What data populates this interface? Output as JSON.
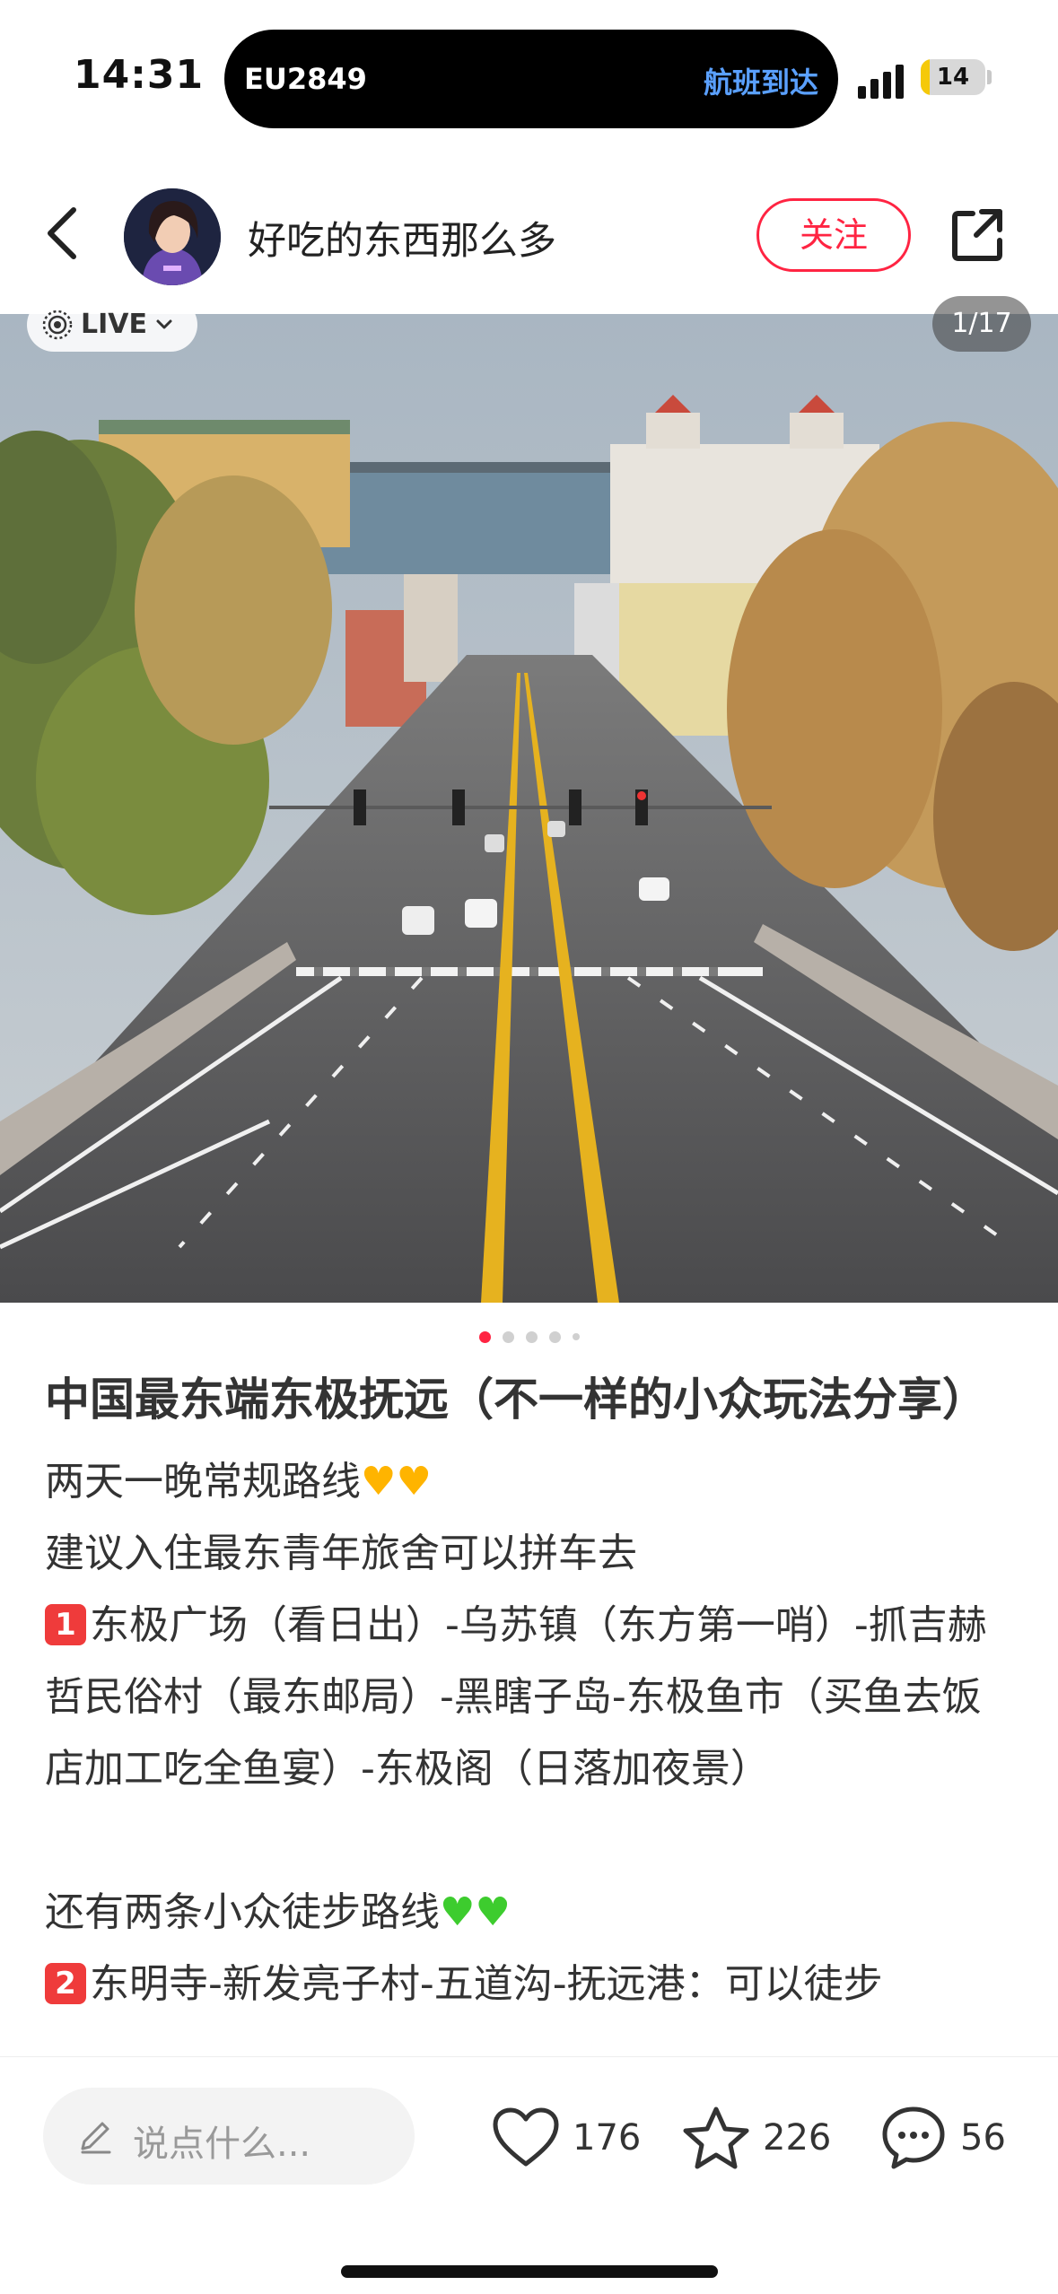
{
  "status_bar": {
    "time": "14:31",
    "flight_number": "EU2849",
    "flight_status": "航班到达",
    "battery_level": "14",
    "battery_percent": 14
  },
  "header": {
    "author_name": "好吃的东西那么多",
    "follow_label": "关注",
    "icons": [
      "back-icon",
      "avatar",
      "share-icon"
    ]
  },
  "media": {
    "live_label": "LIVE",
    "page_counter": "1/17",
    "dot_count": 5,
    "active_dot": 0
  },
  "post": {
    "title": "中国最东端东极抚远（不一样的小众玩法分享）",
    "lines": [
      {
        "text": "两天一晚常规路线",
        "emoji": "yellow-hearts"
      },
      {
        "text": "建议入住最东青年旅舍可以拼车去"
      },
      {
        "badge": "1",
        "text": "东极广场（看日出）-乌苏镇（东方第一哨）-抓吉赫哲民俗村（最东邮局）-黑瞎子岛-东极鱼市（买鱼去饭店加工吃全鱼宴）-东极阁（日落加夜景）"
      },
      {
        "text": ""
      },
      {
        "text": "还有两条小众徒步路线",
        "emoji": "green-hearts"
      },
      {
        "badge": "2",
        "text": "东明寺-新发亮子村-五道沟-抚远港：可以徒步"
      }
    ]
  },
  "bottom_bar": {
    "comment_placeholder": "说点什么...",
    "likes": "176",
    "favorites": "226",
    "comments": "56"
  }
}
